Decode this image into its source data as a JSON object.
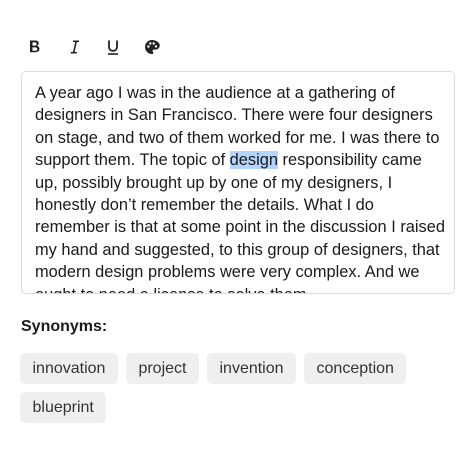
{
  "toolbar": {
    "bold": "B",
    "italic": "I",
    "underline": "U",
    "color_icon": "palette-icon"
  },
  "editor": {
    "text_before": "A year ago I was in the audience at a gathering of designers in San Francisco. There were four designers on stage, and two of them worked for me. I was there to support them. The topic of ",
    "selected_word": "design",
    "text_after": " responsibility came up, possibly brought up by one of my designers, I honestly don’t remember the details. What I do remember is that at some point in the discussion I raised my hand and suggested, to this group of designers, that modern design problems were very complex. And we ought to need a license to solve them.",
    "highlight_color": "#b3d4fc"
  },
  "synonyms": {
    "heading": "Synonyms:",
    "items": [
      "innovation",
      "project",
      "invention",
      "conception",
      "blueprint"
    ]
  }
}
